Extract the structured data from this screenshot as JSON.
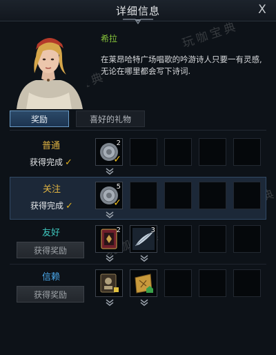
{
  "window": {
    "title": "详细信息",
    "close_label": "X"
  },
  "npc": {
    "name": "希拉",
    "description": "在莱昂哈特广场唱歌的吟游诗人只要一有灵感,无论在哪里都会写下诗词."
  },
  "tabs": [
    {
      "label": "奖励",
      "active": true
    },
    {
      "label": "喜好的礼物",
      "active": false
    }
  ],
  "rows": [
    {
      "tier": "普通",
      "tier_color": "#e0b342",
      "status": "获得完成",
      "claimed": true,
      "rewards": [
        {
          "icon": "coin-token-icon",
          "qty": "2",
          "claimed": true
        }
      ]
    },
    {
      "tier": "关注",
      "tier_color": "#e0b342",
      "status": "获得完成",
      "claimed": true,
      "highlighted": true,
      "rewards": [
        {
          "icon": "coin-token-icon",
          "qty": "5",
          "claimed": true
        }
      ]
    },
    {
      "tier": "友好",
      "tier_color": "#3fc9c0",
      "button_label": "获得奖励",
      "claimed": false,
      "rewards": [
        {
          "icon": "card-icon",
          "qty": "2"
        },
        {
          "icon": "feather-icon",
          "qty": "3"
        }
      ]
    },
    {
      "tier": "信赖",
      "tier_color": "#4aa6e8",
      "button_label": "获得奖励",
      "claimed": false,
      "rewards": [
        {
          "icon": "portrait-scroll-icon",
          "qty": ""
        },
        {
          "icon": "map-house-icon",
          "qty": ""
        }
      ]
    }
  ],
  "watermarks": [
    "玩咖宝典",
    "玩咖宝典",
    "玩咖宝典",
    "玩咖宝典"
  ],
  "colors": {
    "accent": "#87c53a",
    "check": "#e0b020",
    "tab_active": "#2c4a68"
  }
}
